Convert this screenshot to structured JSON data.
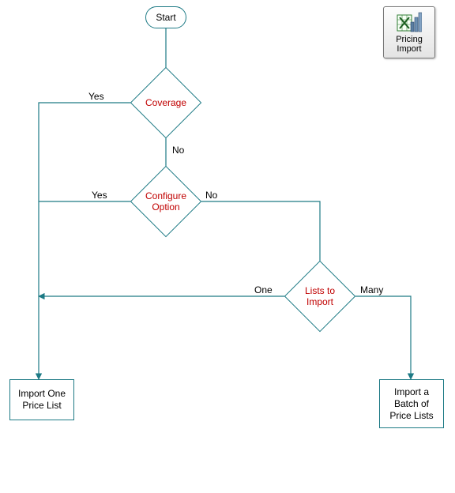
{
  "flow": {
    "start": "Start",
    "decisions": {
      "coverage": {
        "label": "Coverage",
        "yes": "Yes",
        "no": "No"
      },
      "configure": {
        "label": "Configure\nOption",
        "yes": "Yes",
        "no": "No"
      },
      "lists": {
        "label": "Lists to\nImport",
        "one": "One",
        "many": "Many"
      }
    },
    "processes": {
      "import_one": "Import One\nPrice List",
      "import_batch": "Import a\nBatch of\nPrice Lists"
    }
  },
  "tool": {
    "line1": "Pricing",
    "line2": "Import",
    "icon_name": "excel-chart-icon"
  },
  "colors": {
    "stroke": "#1d7a85",
    "decision_text": "#c00000"
  }
}
